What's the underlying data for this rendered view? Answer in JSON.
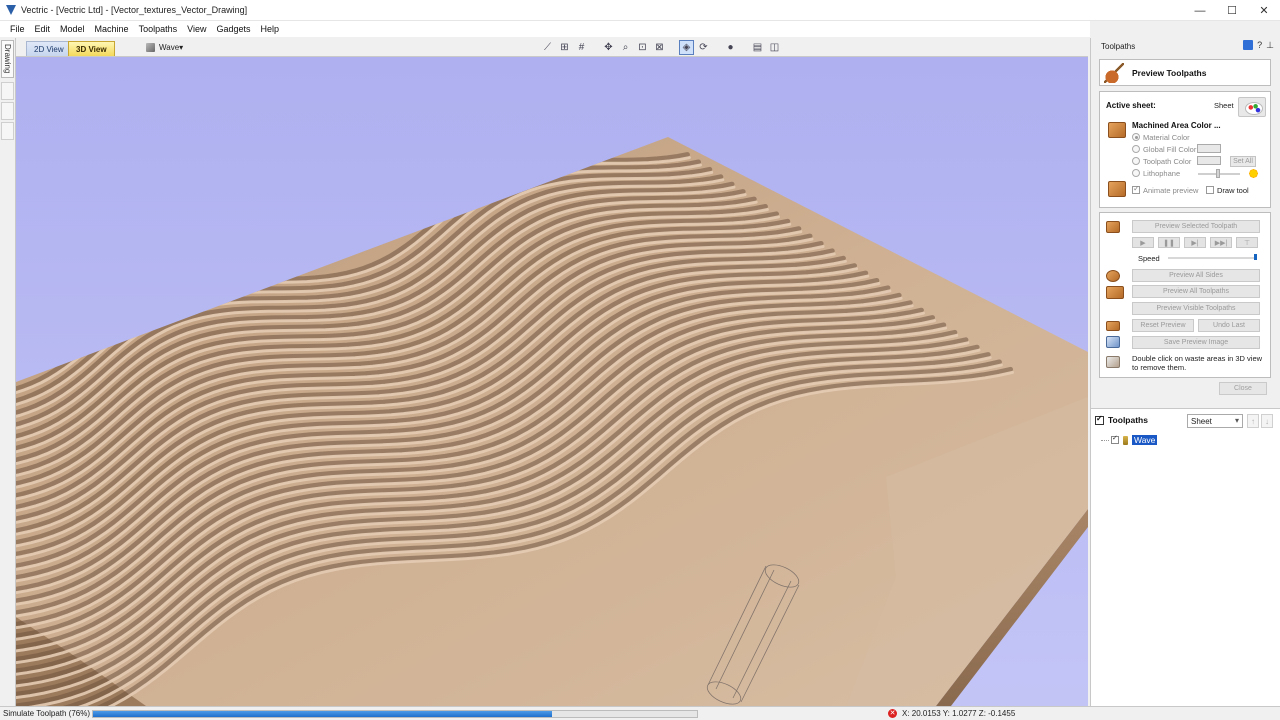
{
  "window": {
    "title": "Vectric - [Vectric Ltd] - [Vector_textures_Vector_Drawing]",
    "controls": {
      "minimize": "—",
      "maximize": "☐",
      "close": "✕"
    }
  },
  "menu": [
    "File",
    "Edit",
    "Model",
    "Machine",
    "Toolpaths",
    "View",
    "Gadgets",
    "Help"
  ],
  "left_strip": {
    "tab": "Drawing"
  },
  "view_tabs": {
    "tab_2d": "2D View",
    "tab_3d": "3D View",
    "model_dropdown": "Wave"
  },
  "right_panel": {
    "header": "Toolpaths",
    "preview_title": "Preview Toolpaths",
    "active_sheet_label": "Active sheet:",
    "active_sheet_value": "Sheet",
    "machined_area_label": "Machined Area Color ...",
    "options": {
      "material_color": "Material Color",
      "global_fill_color": "Global Fill Color",
      "toolpath_color": "Toolpath Color",
      "lithophane": "Lithophane",
      "set_all": "Set All",
      "animate_preview": "Animate preview",
      "draw_tool": "Draw tool"
    },
    "buttons": {
      "preview_selected": "Preview Selected Toolpath",
      "speed": "Speed",
      "preview_all_sides": "Preview All Sides",
      "preview_all_toolpaths": "Preview All Toolpaths",
      "preview_visible": "Preview Visible Toolpaths",
      "reset_preview": "Reset Preview",
      "undo_last": "Undo Last",
      "save_preview_image": "Save Preview Image",
      "close": "Close"
    },
    "hint": "Double click on waste areas in 3D view to remove them.",
    "toolpaths_list": {
      "title": "Toolpaths",
      "sheet_select": "Sheet",
      "items": [
        "Wave"
      ]
    }
  },
  "status": {
    "text": "Simulate Toolpath (76%)",
    "progress": 0.76,
    "coords": "X: 20.0153 Y: 1.0277 Z: -0.1455"
  },
  "colors": {
    "viewport_bg": "#b3b4f2",
    "wood": "#c9a887",
    "accent": "#1a58c6"
  }
}
